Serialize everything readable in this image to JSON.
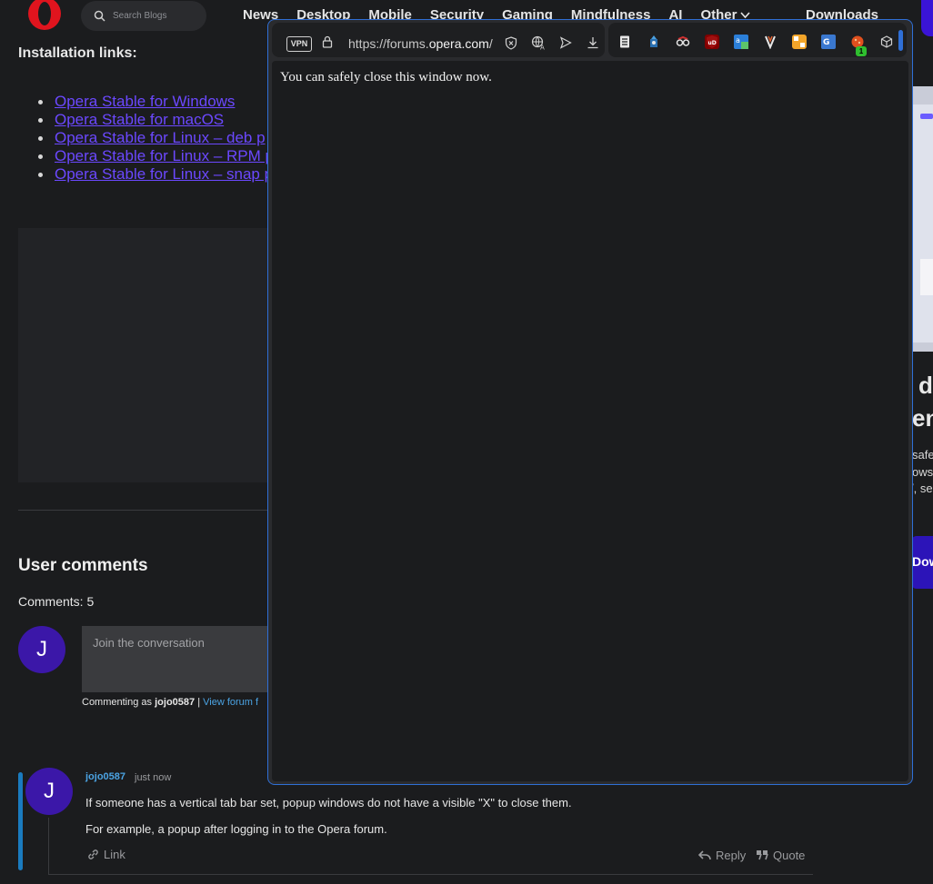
{
  "header": {
    "search_placeholder": "Search Blogs",
    "nav": [
      "News",
      "Desktop",
      "Mobile",
      "Security",
      "Gaming",
      "Mindfulness",
      "AI",
      "Other"
    ],
    "downloads": "Downloads"
  },
  "article": {
    "install_heading": "Installation links:",
    "links": [
      "Opera Stable for Windows",
      "Opera Stable for macOS",
      "Opera Stable for Linux – deb p",
      "Opera Stable for Linux – RPM p",
      "Opera Stable for Linux – snap p"
    ]
  },
  "right_edge": {
    "heading1": "d",
    "heading2": "en",
    "text1": "safer",
    "text2": "ows",
    "text3": "/, se",
    "button": "Dow"
  },
  "comments": {
    "title": "User comments",
    "count_label": "Comments: 5",
    "avatar_letter": "J",
    "join_placeholder": "Join the conversation",
    "commenting_as_prefix": "Commenting as",
    "commenting_as_user": "jojo0587",
    "separator": "|",
    "view_forum": "View forum f",
    "items": [
      {
        "user": "jojo0587",
        "time": "just now",
        "text1": "If someone has a vertical tab bar set, popup windows do not have a visible \"X\" to close them.",
        "text2": "For example, a popup after logging in to the Opera forum.",
        "link_label": "Link",
        "reply_label": "Reply",
        "quote_label": "Quote"
      }
    ]
  },
  "popup": {
    "vpn_label": "VPN",
    "url_prefix": "https://forums.",
    "url_domain": "opera.com",
    "url_suffix": "/",
    "message": "You can safely close this window now.",
    "badge_count": "1",
    "accent_color": "#2f6fd6"
  }
}
